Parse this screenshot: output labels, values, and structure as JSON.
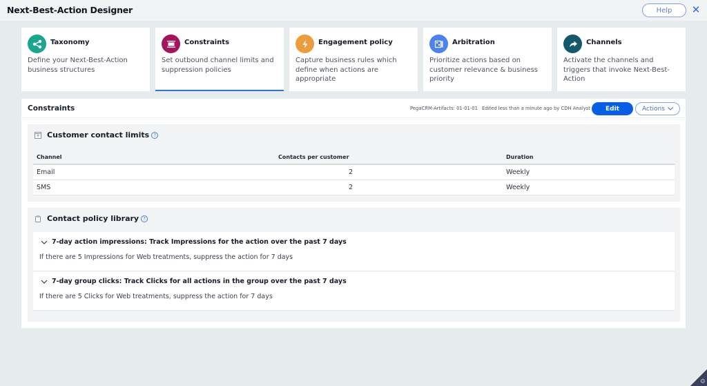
{
  "header": {
    "title": "Next-Best-Action Designer",
    "help_label": "Help",
    "close_glyph": "✕"
  },
  "cards": [
    {
      "title": "Taxonomy",
      "description": "Define your Next-Best-Action business structures",
      "icon": "share-nodes-icon",
      "color": "#1aa591",
      "active": false
    },
    {
      "title": "Constraints",
      "description": "Set outbound channel limits and suppression policies",
      "icon": "constraints-icon",
      "color": "#a5145a",
      "active": true
    },
    {
      "title": "Engagement policy",
      "description": "Capture business rules which define when actions are appropriate",
      "icon": "lightning-icon",
      "color": "#eb9d3e",
      "active": false
    },
    {
      "title": "Arbitration",
      "description": "Prioritize actions based on customer relevance & business priority",
      "icon": "arbitration-icon",
      "color": "#4b82f0",
      "active": false
    },
    {
      "title": "Channels",
      "description": "Activate the channels and triggers that invoke Next-Best-Action",
      "icon": "forward-arrow-icon",
      "color": "#14596b",
      "active": false
    }
  ],
  "main": {
    "title": "Constraints",
    "ruleset": "PegaCRM-Artifacts: 01-01-01",
    "edited": "Edited less than a minute ago by CDH Analyst",
    "edit_label": "Edit",
    "actions_label": "Actions",
    "accent": "#075ee5"
  },
  "contact_limits": {
    "title": "Customer contact limits",
    "help_glyph": "?",
    "columns": [
      "Channel",
      "Contacts per customer",
      "Duration"
    ],
    "rows": [
      {
        "channel": "Email",
        "contacts": "2",
        "duration": "Weekly"
      },
      {
        "channel": "SMS",
        "contacts": "2",
        "duration": "Weekly"
      }
    ]
  },
  "policy_library": {
    "title": "Contact policy library",
    "help_glyph": "?",
    "policies": [
      {
        "title": "7-day action impressions: Track Impressions for the action over the past 7 days",
        "description": "If there are 5 Impressions for Web treatments, suppress the action for 7 days"
      },
      {
        "title": "7-day group clicks: Track Clicks for all actions in the group over the past 7 days",
        "description": "If there are 5 Clicks for Web treatments, suppress the action for 7 days"
      }
    ]
  }
}
